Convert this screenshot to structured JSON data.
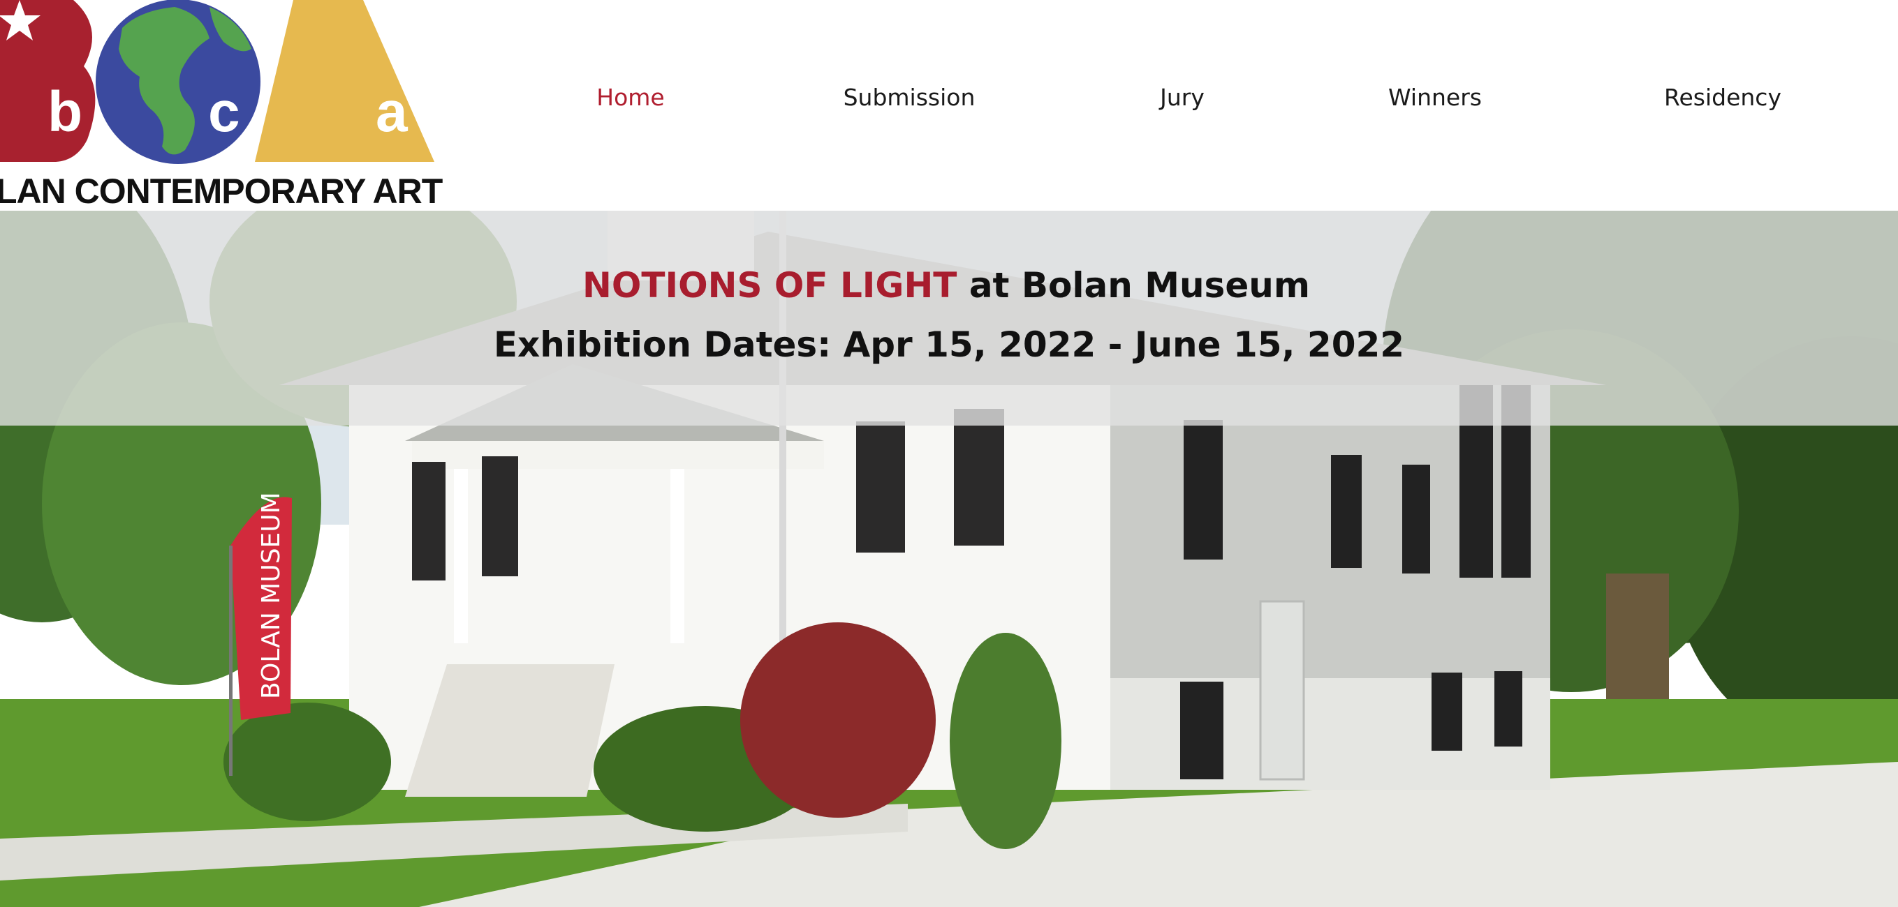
{
  "logo": {
    "text": "LAN CONTEMPORARY ART",
    "letters": [
      "b",
      "c",
      "a"
    ],
    "colors": {
      "red": "#a8212f",
      "blue": "#3b4a9f",
      "green": "#55a34f",
      "yellow": "#e6b94f"
    }
  },
  "nav": {
    "items": [
      {
        "label": "Home",
        "active": true
      },
      {
        "label": "Submission",
        "active": false
      },
      {
        "label": "Jury",
        "active": false
      },
      {
        "label": "Winners",
        "active": false
      },
      {
        "label": "Residency",
        "active": false
      }
    ],
    "active_color": "#b01e2f"
  },
  "hero": {
    "title_highlight": "NOTIONS OF LIGHT",
    "title_rest": " at Bolan Museum",
    "dates": "Exhibition Dates: Apr 15, 2022 - June 15, 2022",
    "flag_text": "BOLAN MUSEUM",
    "accent_color": "#a81d2e"
  }
}
